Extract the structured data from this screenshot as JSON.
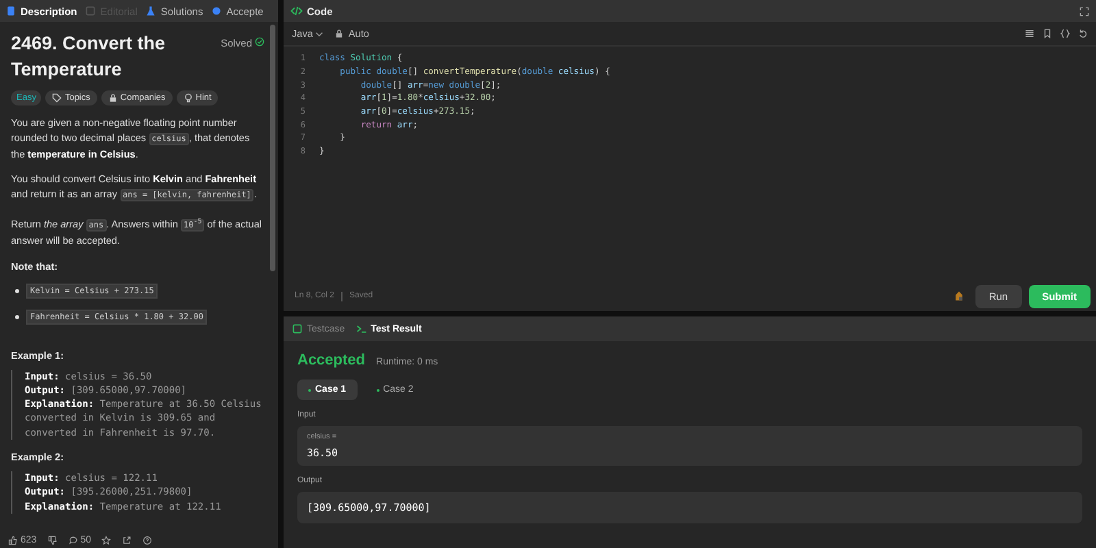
{
  "left_tabs": [
    {
      "label": "Description",
      "selected": true,
      "disabled": false
    },
    {
      "label": "Editorial",
      "selected": false,
      "disabled": true
    },
    {
      "label": "Solutions",
      "selected": false,
      "disabled": false
    },
    {
      "label": "Accepte",
      "selected": false,
      "disabled": false
    }
  ],
  "problem": {
    "title": "2469. Convert the Temperature",
    "status": "Solved",
    "difficulty": "Easy",
    "tags": [
      {
        "label": "Topics"
      },
      {
        "label": "Companies"
      },
      {
        "label": "Hint"
      }
    ],
    "paragraphs": [
      [
        {
          "kind": "text",
          "text": "You are given a non-negative floating point number rounded to two decimal places "
        },
        {
          "kind": "code",
          "text": "celsius"
        },
        {
          "kind": "text",
          "text": ", that denotes the "
        },
        {
          "kind": "bold",
          "text": "temperature in Celsius"
        },
        {
          "kind": "text",
          "text": "."
        }
      ],
      [
        {
          "kind": "text",
          "text": "You should convert Celsius into "
        },
        {
          "kind": "bold",
          "text": "Kelvin"
        },
        {
          "kind": "text",
          "text": " and "
        },
        {
          "kind": "bold",
          "text": "Fahrenheit"
        },
        {
          "kind": "text",
          "text": " and return it as an array "
        },
        {
          "kind": "code",
          "text": "ans = [kelvin, fahrenheit]"
        },
        {
          "kind": "text",
          "text": "."
        }
      ],
      [
        {
          "kind": "text",
          "text": "Return "
        },
        {
          "kind": "italic",
          "text": "the array "
        },
        {
          "kind": "code",
          "text": "ans"
        },
        {
          "kind": "text",
          "text": ". Answers within "
        },
        {
          "kind": "code",
          "text": "10$^{-5}$"
        },
        {
          "kind": "text",
          "text": " of the actual answer will be accepted."
        }
      ]
    ],
    "note_heading": "Note that:",
    "notes": [
      "Kelvin = Celsius + 273.15",
      "Fahrenheit = Celsius * 1.80 + 32.00"
    ],
    "examples": [
      {
        "heading": "Example 1:",
        "lines": [
          {
            "label": "Input:",
            "value": "celsius = 36.50"
          },
          {
            "label": "Output:",
            "value": "[309.65000,97.70000]"
          },
          {
            "label": "Explanation:",
            "value": "Temperature at 36.50 Celsius converted in Kelvin is 309.65 and converted in Fahrenheit is 97.70."
          }
        ]
      },
      {
        "heading": "Example 2:",
        "lines": [
          {
            "label": "Input:",
            "value": "celsius = 122.11"
          },
          {
            "label": "Output:",
            "value": "[395.26000,251.79800]"
          },
          {
            "label": "Explanation:",
            "value": "Temperature at 122.11"
          }
        ]
      }
    ]
  },
  "footer": {
    "likes": "623",
    "comments": "50"
  },
  "code_panel": {
    "title": "Code",
    "language": "Java",
    "mode": "Auto",
    "lines": [
      {
        "number": "1",
        "tokens": [
          {
            "kind": "kw",
            "text": "class"
          },
          {
            "kind": "cls",
            "text": " Solution"
          },
          {
            "kind": "plain",
            "text": " {"
          }
        ]
      },
      {
        "number": "2",
        "tokens": [
          {
            "kind": "kw",
            "text": "    public"
          },
          {
            "kind": "kw",
            "text": " double"
          },
          {
            "kind": "plain",
            "text": "[] "
          },
          {
            "kind": "fn",
            "text": "convertTemperature"
          },
          {
            "kind": "plain",
            "text": "("
          },
          {
            "kind": "kw",
            "text": "double"
          },
          {
            "kind": "var",
            "text": " celsius"
          },
          {
            "kind": "plain",
            "text": ") {"
          }
        ]
      },
      {
        "number": "3",
        "tokens": [
          {
            "kind": "kw",
            "text": "        double"
          },
          {
            "kind": "plain",
            "text": "[] "
          },
          {
            "kind": "var",
            "text": "arr"
          },
          {
            "kind": "plain",
            "text": "="
          },
          {
            "kind": "kw",
            "text": "new"
          },
          {
            "kind": "kw",
            "text": " double"
          },
          {
            "kind": "plain",
            "text": "["
          },
          {
            "kind": "num",
            "text": "2"
          },
          {
            "kind": "plain",
            "text": "];"
          }
        ]
      },
      {
        "number": "4",
        "tokens": [
          {
            "kind": "var",
            "text": "        arr"
          },
          {
            "kind": "plain",
            "text": "["
          },
          {
            "kind": "num",
            "text": "1"
          },
          {
            "kind": "plain",
            "text": "]="
          },
          {
            "kind": "num",
            "text": "1.80"
          },
          {
            "kind": "plain",
            "text": "*"
          },
          {
            "kind": "var",
            "text": "celsius"
          },
          {
            "kind": "plain",
            "text": "+"
          },
          {
            "kind": "num",
            "text": "32.00"
          },
          {
            "kind": "plain",
            "text": ";"
          }
        ]
      },
      {
        "number": "5",
        "tokens": [
          {
            "kind": "var",
            "text": "        arr"
          },
          {
            "kind": "plain",
            "text": "["
          },
          {
            "kind": "num",
            "text": "0"
          },
          {
            "kind": "plain",
            "text": "]="
          },
          {
            "kind": "var",
            "text": "celsius"
          },
          {
            "kind": "plain",
            "text": "+"
          },
          {
            "kind": "num",
            "text": "273.15"
          },
          {
            "kind": "plain",
            "text": ";"
          }
        ]
      },
      {
        "number": "6",
        "tokens": [
          {
            "kind": "ret",
            "text": "        return"
          },
          {
            "kind": "var",
            "text": " arr"
          },
          {
            "kind": "plain",
            "text": ";"
          }
        ]
      },
      {
        "number": "7",
        "tokens": [
          {
            "kind": "plain",
            "text": "    }"
          }
        ]
      },
      {
        "number": "8",
        "tokens": [
          {
            "kind": "plain",
            "text": "}"
          }
        ]
      }
    ],
    "status": "Ln 8, Col 2",
    "save_state": "Saved",
    "run": "Run",
    "submit": "Submit"
  },
  "result_panel": {
    "tabs": [
      {
        "label": "Testcase",
        "selected": false
      },
      {
        "label": "Test Result",
        "selected": true
      }
    ],
    "verdict": "Accepted",
    "runtime": "Runtime: 0 ms",
    "cases": [
      {
        "label": "Case 1",
        "selected": true
      },
      {
        "label": "Case 2",
        "selected": false
      }
    ],
    "input_label": "Input",
    "input_name": "celsius =",
    "input_value": "36.50",
    "output_label": "Output",
    "output_value": "[309.65000,97.70000]"
  }
}
